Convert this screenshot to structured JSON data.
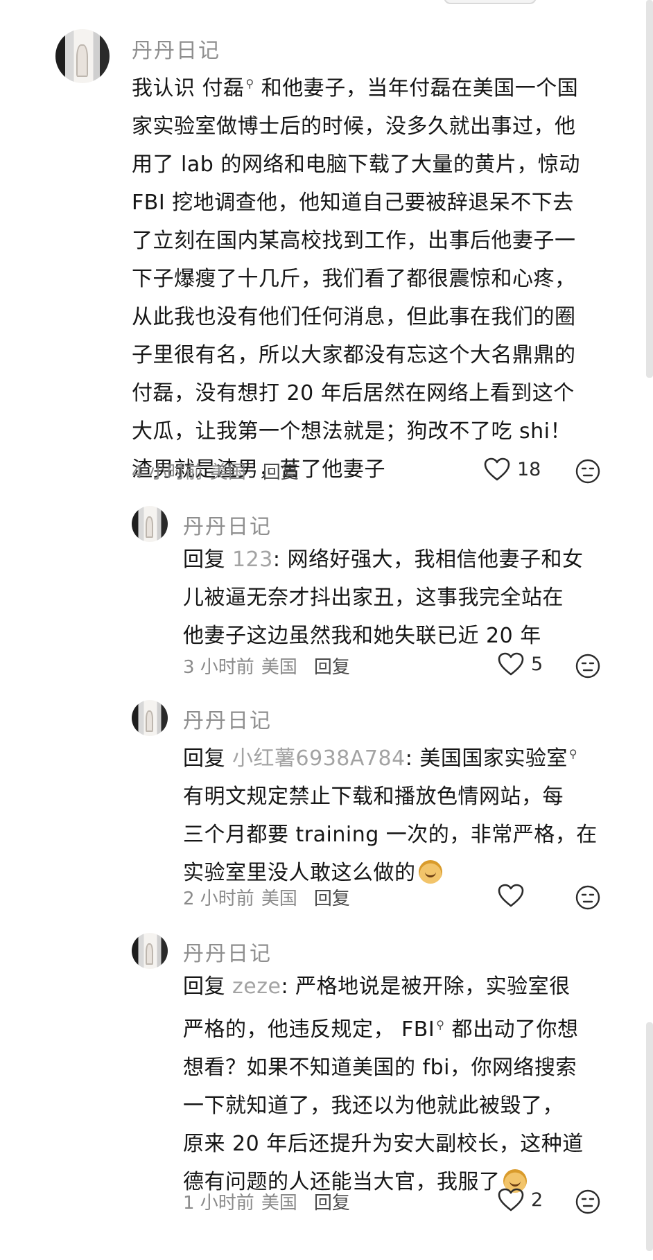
{
  "comments": [
    {
      "username": "丹丹日记",
      "lines": [
        {
          "before": "我认识 ",
          "mention": "",
          "highlight": "付磊",
          "after": " 和他妻子，当年付磊在美国一个国"
        },
        {
          "text": "家实验室做博士后的时候，没多久就出事过，他"
        },
        {
          "text": "用了 lab 的网络和电脑下载了大量的黄片，惊动"
        },
        {
          "text": "FBI 挖地调查他，他知道自己要被辞退呆不下去"
        },
        {
          "text": "了立刻在国内某高校找到工作，出事后他妻子一"
        },
        {
          "text": "下子爆瘦了十几斤，我们看了都很震惊和心疼，"
        },
        {
          "text": "从此我也没有他们任何消息，但此事在我们的圈"
        },
        {
          "text": "子里很有名，所以大家都没有忘这个大名鼎鼎的"
        },
        {
          "text": "付磊，没有想打 20 年后居然在网络上看到这个"
        },
        {
          "text": "大瓜，让我第一个想法就是；狗改不了吃 shi！"
        },
        {
          "text": "渣男就是渣男，苦了他妻子"
        }
      ],
      "time": "4 小时前",
      "location": "美国",
      "reply_label": "回复",
      "likes": "18"
    },
    {
      "username": "丹丹日记",
      "reply_prefix": "回复 ",
      "reply_to": "123",
      "lines": [
        {
          "text": "网络好强大，我相信他妻子和女"
        },
        {
          "text": "儿被逼无奈才抖出家丑，这事我完全站在"
        },
        {
          "text": "他妻子这边虽然我和她失联已近 20 年"
        }
      ],
      "time": "3 小时前",
      "location": "美国",
      "reply_label": "回复",
      "likes": "5"
    },
    {
      "username": "丹丹日记",
      "reply_prefix": "回复 ",
      "reply_to": "小红薯6938A784",
      "lines": [
        {
          "text": "美国国家实验室"
        },
        {
          "text": "有明文规定禁止下载和播放色情网站，每"
        },
        {
          "text": "三个月都要 training 一次的，非常严格，在"
        },
        {
          "text": "实验室里没人敢这么做的"
        }
      ],
      "time": "2 小时前",
      "location": "美国",
      "reply_label": "回复",
      "likes": ""
    },
    {
      "username": "丹丹日记",
      "reply_prefix": "回复 ",
      "reply_to": "zeze",
      "lines": [
        {
          "text": "严格地说是被开除，实验室很"
        },
        {
          "text": "严格的，他违反规定， FBI"
        },
        {
          "text": "想看？如果不知道美国的 fbi，你网络搜索"
        },
        {
          "text": "一下就知道了，我还以为他就此被毁了，"
        },
        {
          "text": "原来 20 年后还提升为安大副校长，这种道"
        },
        {
          "text": "德有问题的人还能当大官，我服了"
        }
      ],
      "line2_after": " 都出动了你想",
      "time": "1 小时前",
      "location": "美国",
      "reply_label": "回复",
      "likes": "2"
    }
  ],
  "icons": {
    "like": "heart-outline-icon",
    "dislike": "unamused-face-icon",
    "search_link": "magnifier-icon",
    "emoji": "mango-face-emoji"
  },
  "colors": {
    "text": "#161616",
    "username": "#8e8e8e",
    "meta": "#8a8a8a",
    "mention": "#a3a3a3"
  }
}
